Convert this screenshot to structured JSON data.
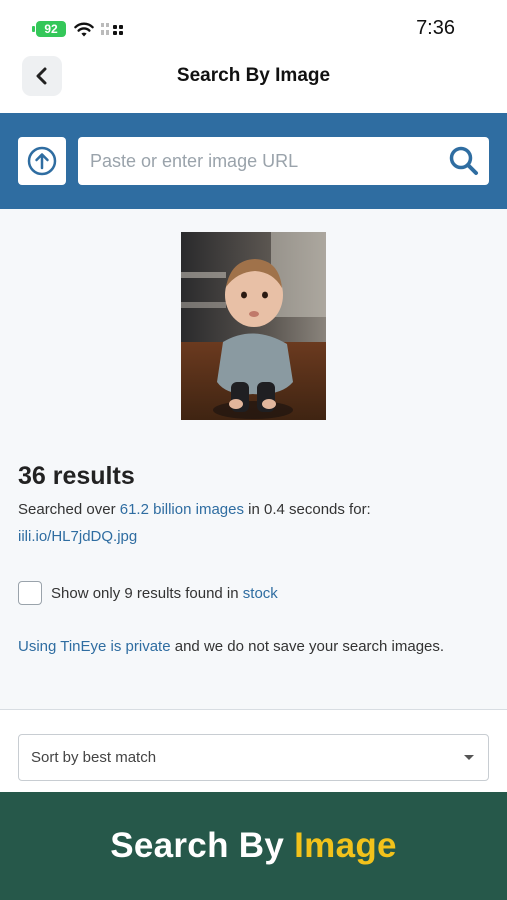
{
  "status_bar": {
    "battery": "92",
    "time": "7:36"
  },
  "nav": {
    "title": "Search By Image"
  },
  "search": {
    "placeholder": "Paste or enter image URL"
  },
  "results": {
    "count_text": "36 results",
    "summary_prefix": "Searched over",
    "summary_link": "61.2 billion images",
    "summary_suffix": "in 0.4 seconds for:",
    "source_link": "iili.io/HL7jdDQ.jpg",
    "stock_prefix": "Show only 9 results found in",
    "stock_link": "stock",
    "stock_checked": false,
    "privacy_link": "Using TinEye is private",
    "privacy_text": "and we do not save your search images."
  },
  "sort": {
    "selected": "Sort by best match"
  },
  "banner": {
    "text_main": "Search By",
    "text_accent": "Image",
    "accent_color": "#f2c21b",
    "background": "#26584a"
  },
  "colors": {
    "brand_blue": "#2f6da1",
    "battery_green": "#34c759"
  },
  "icons": {
    "back": "chevron-left-icon",
    "upload": "upload-arrow-icon",
    "search": "magnifier-icon"
  }
}
